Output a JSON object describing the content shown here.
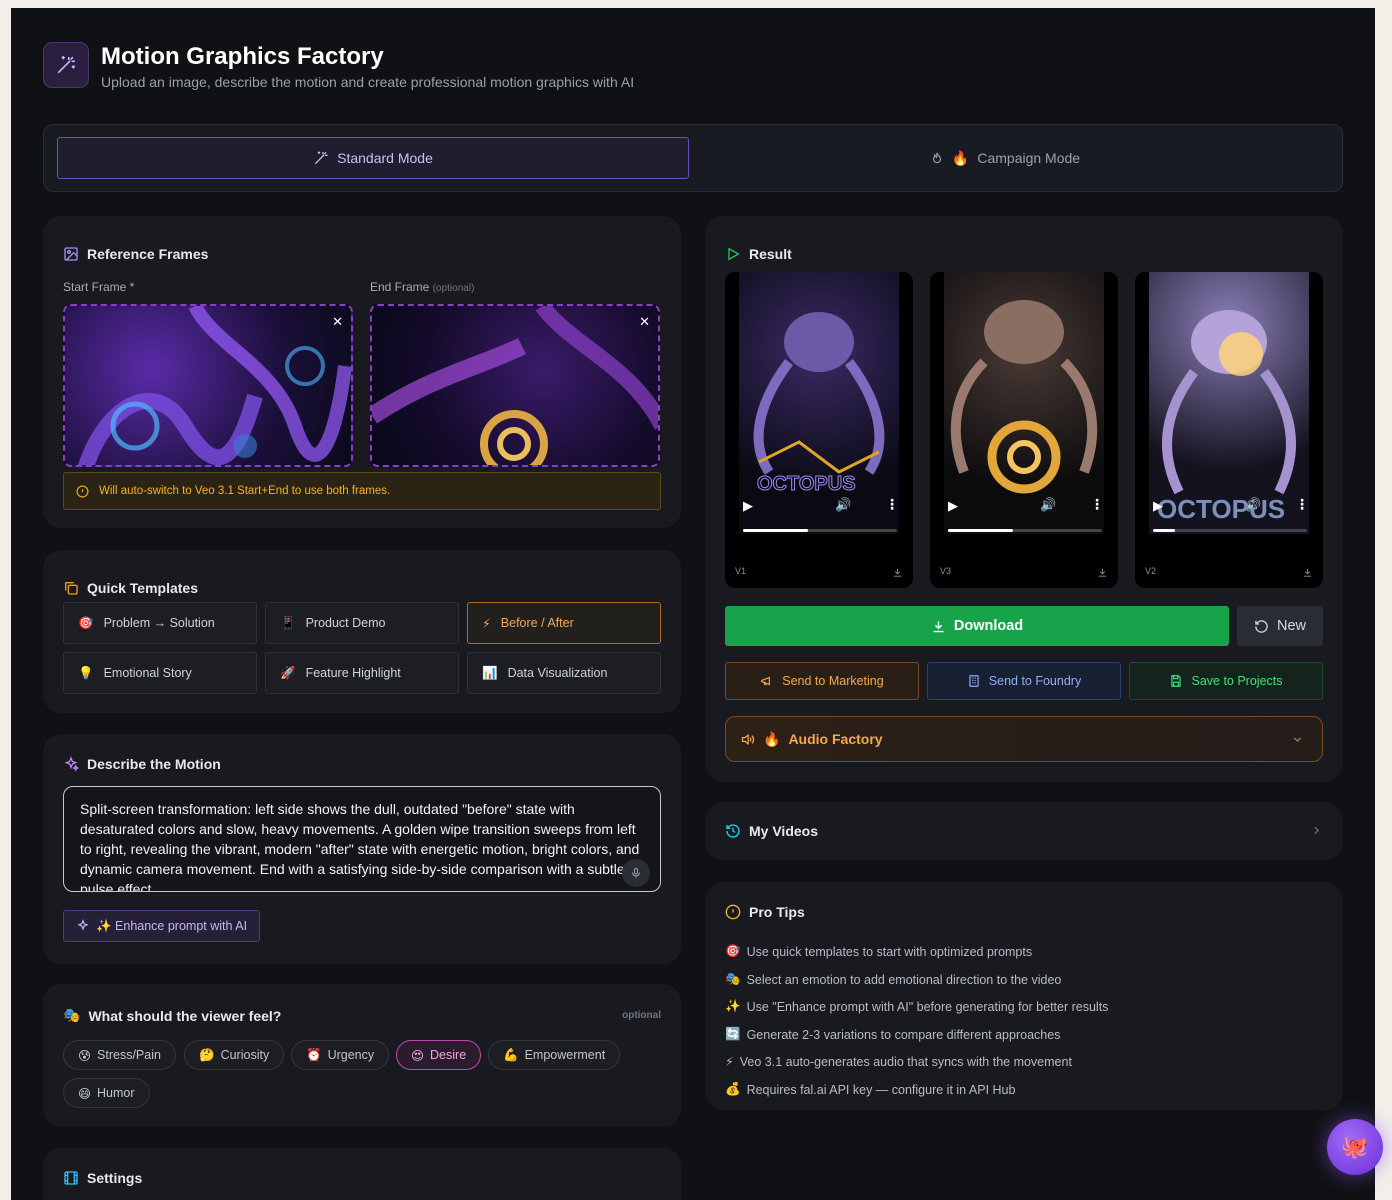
{
  "header": {
    "title": "Motion Graphics Factory",
    "subtitle": "Upload an image, describe the motion and create professional motion graphics with AI"
  },
  "modes": {
    "standard": "Standard Mode",
    "campaign": "Campaign Mode",
    "active": "standard"
  },
  "reference_frames": {
    "title": "Reference Frames",
    "start_label": "Start Frame *",
    "end_label": "End Frame",
    "end_optional": "(optional)",
    "notice": "Will auto-switch to Veo 3.1 Start+End to use both frames."
  },
  "templates": {
    "title": "Quick Templates",
    "items": [
      {
        "icon": "🎯",
        "label": "Problem → Solution"
      },
      {
        "icon": "📱",
        "label": "Product Demo"
      },
      {
        "icon": "⚡",
        "label": "Before / After",
        "active": true
      },
      {
        "icon": "💡",
        "label": "Emotional Story"
      },
      {
        "icon": "🚀",
        "label": "Feature Highlight"
      },
      {
        "icon": "📊",
        "label": "Data Visualization"
      }
    ]
  },
  "motion": {
    "title": "Describe the Motion",
    "text": "Split-screen transformation: left side shows the dull, outdated \"before\" state with desaturated colors and slow, heavy movements. A golden wipe transition sweeps from left to right, revealing the vibrant, modern \"after\" state with energetic motion, bright colors, and dynamic camera movement. End with a satisfying side-by-side comparison with a subtle pulse effect.",
    "enhance_label": "✨ Enhance prompt with AI"
  },
  "feel": {
    "title": "What should the viewer feel?",
    "optional": "optional",
    "chips": [
      {
        "icon": "😰",
        "label": "Stress/Pain"
      },
      {
        "icon": "🤔",
        "label": "Curiosity"
      },
      {
        "icon": "⏰",
        "label": "Urgency"
      },
      {
        "icon": "😍",
        "label": "Desire",
        "active": true
      },
      {
        "icon": "💪",
        "label": "Empowerment"
      },
      {
        "icon": "😄",
        "label": "Humor"
      }
    ]
  },
  "settings": {
    "title": "Settings"
  },
  "result": {
    "title": "Result",
    "overlay_text": "OCTOPUS",
    "videos": [
      {
        "label": "V1",
        "progress": 0.42
      },
      {
        "label": "V3",
        "progress": 0.42
      },
      {
        "label": "V2",
        "progress": 0.14
      }
    ],
    "download": "Download",
    "new": "New",
    "send_marketing": "Send to Marketing",
    "send_foundry": "Send to Foundry",
    "save_projects": "Save to Projects",
    "audio_factory": "Audio Factory"
  },
  "my_videos": {
    "title": "My Videos"
  },
  "pro_tips": {
    "title": "Pro Tips",
    "items": [
      {
        "icon": "🎯",
        "text": "Use quick templates to start with optimized prompts"
      },
      {
        "icon": "🎭",
        "text": "Select an emotion to add emotional direction to the video"
      },
      {
        "icon": "✨",
        "text": "Use \"Enhance prompt with AI\" before generating for better results"
      },
      {
        "icon": "🔄",
        "text": "Generate 2-3 variations to compare different approaches"
      },
      {
        "icon": "⚡",
        "text": "Veo 3.1 auto-generates audio that syncs with the movement"
      },
      {
        "icon": "💰",
        "text": "Requires fal.ai API key — configure it in API Hub"
      }
    ]
  },
  "colors": {
    "accent": "#8b5cf6",
    "download": "#16a34a",
    "warning": "#f0b429",
    "audio": "#f4a950"
  }
}
